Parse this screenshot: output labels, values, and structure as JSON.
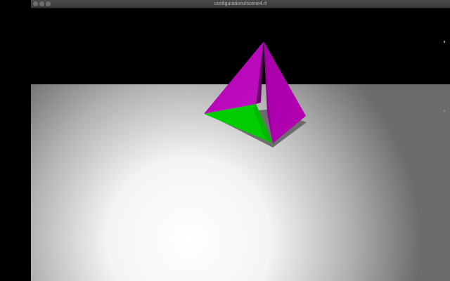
{
  "window": {
    "title": "configurations/scene4.rt"
  },
  "scene": {
    "sky_color": "#000000",
    "floor_light": "#ffffff",
    "floor_dark": "#6b6b6b",
    "pyramid_side_color": "#b000b0",
    "pyramid_side_dark": "#8e008e",
    "pyramid_base_color": "#00cc00",
    "shadow_color": "#5a5a5a"
  }
}
